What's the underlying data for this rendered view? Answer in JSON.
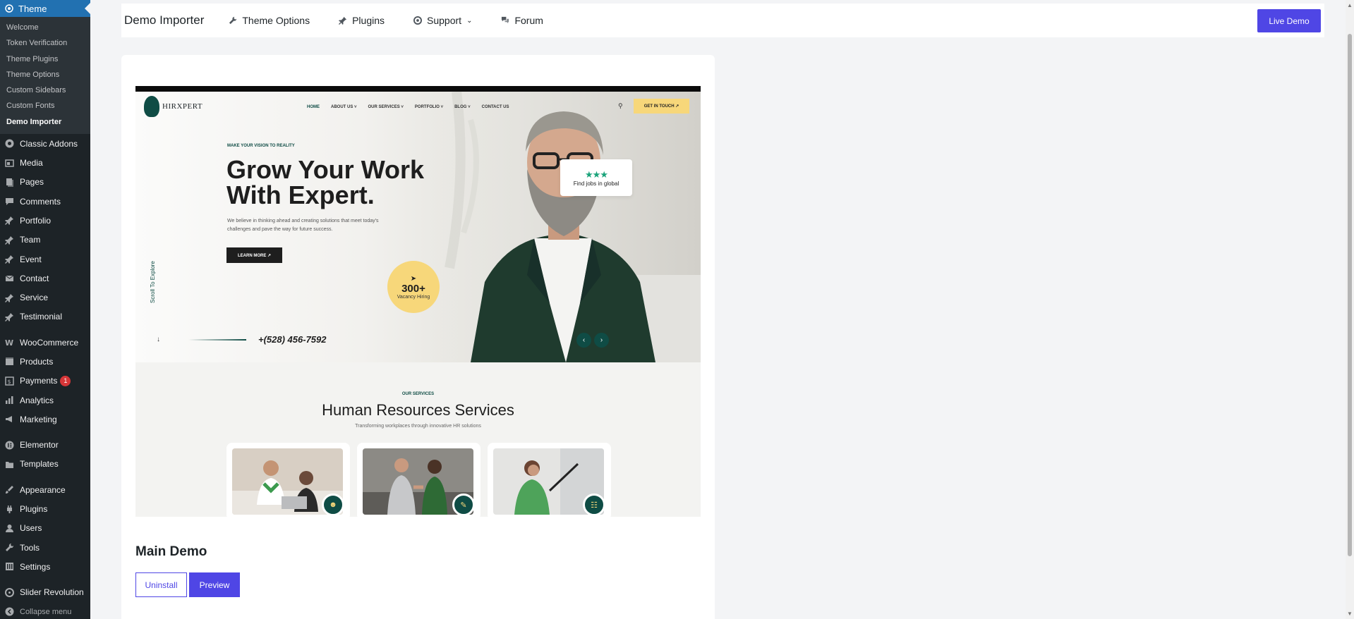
{
  "sidebar": {
    "current": "Theme",
    "submenu": [
      "Welcome",
      "Token Verification",
      "Theme Plugins",
      "Theme Options",
      "Custom Sidebars",
      "Custom Fonts",
      "Demo Importer"
    ],
    "items": [
      {
        "label": "Classic Addons",
        "icon": "classic-addons-icon"
      },
      {
        "label": "Media",
        "icon": "media-icon"
      },
      {
        "label": "Pages",
        "icon": "pages-icon"
      },
      {
        "label": "Comments",
        "icon": "comments-icon"
      },
      {
        "label": "Portfolio",
        "icon": "pin-icon"
      },
      {
        "label": "Team",
        "icon": "pin-icon"
      },
      {
        "label": "Event",
        "icon": "pin-icon"
      },
      {
        "label": "Contact",
        "icon": "mail-icon"
      },
      {
        "label": "Service",
        "icon": "pin-icon"
      },
      {
        "label": "Testimonial",
        "icon": "pin-icon"
      },
      {
        "label": "WooCommerce",
        "icon": "woo-icon"
      },
      {
        "label": "Products",
        "icon": "products-icon"
      },
      {
        "label": "Payments",
        "icon": "payments-icon",
        "badge": "1"
      },
      {
        "label": "Analytics",
        "icon": "analytics-icon"
      },
      {
        "label": "Marketing",
        "icon": "marketing-icon"
      },
      {
        "label": "Elementor",
        "icon": "elementor-icon"
      },
      {
        "label": "Templates",
        "icon": "templates-icon"
      },
      {
        "label": "Appearance",
        "icon": "appearance-icon"
      },
      {
        "label": "Plugins",
        "icon": "plugins-icon"
      },
      {
        "label": "Users",
        "icon": "users-icon"
      },
      {
        "label": "Tools",
        "icon": "tools-icon"
      },
      {
        "label": "Settings",
        "icon": "settings-icon"
      },
      {
        "label": "Slider Revolution",
        "icon": "slider-icon"
      }
    ],
    "collapse": "Collapse menu"
  },
  "header": {
    "title": "Demo Importer",
    "nav": [
      {
        "label": "Theme Options",
        "icon": "wrench-icon"
      },
      {
        "label": "Plugins",
        "icon": "plug-icon"
      },
      {
        "label": "Support",
        "icon": "support-icon"
      },
      {
        "label": "Forum",
        "icon": "forum-icon"
      }
    ],
    "live_demo": "Live Demo"
  },
  "preview": {
    "logo": "HIRXPERT",
    "nav": [
      "HOME",
      "ABOUT US ˅",
      "OUR SERVICES ˅",
      "PORTFOLIO ˅",
      "BLOG ˅",
      "CONTACT US"
    ],
    "cta": "GET IN TOUCH ↗",
    "eyebrow": "MAKE YOUR VISION TO REALITY",
    "title_line1": "Grow Your Work",
    "title_line2": "With Expert.",
    "desc": "We believe in thinking ahead and creating solutions that meet today's challenges and pave the way for future success.",
    "learn_more": "LEARN MORE ↗",
    "scroll": "Scroll To Explore",
    "phone": "+(528) 456-7592",
    "badge_num": "300+",
    "badge_label": "Vacancy Hiring",
    "jobs": "Find jobs in global",
    "services_eyebrow": "OUR SERVICES",
    "services_title": "Human Resources Services",
    "services_sub": "Transforming workplaces through innovative HR solutions"
  },
  "demo": {
    "title": "Main Demo",
    "uninstall": "Uninstall",
    "preview": "Preview"
  },
  "colors": {
    "accent": "#4f46e5",
    "wp_sidebar": "#1d2327",
    "wp_blue": "#2271b1",
    "hirxpert_green": "#0f4c45",
    "hirxpert_yellow": "#f7d77a"
  }
}
